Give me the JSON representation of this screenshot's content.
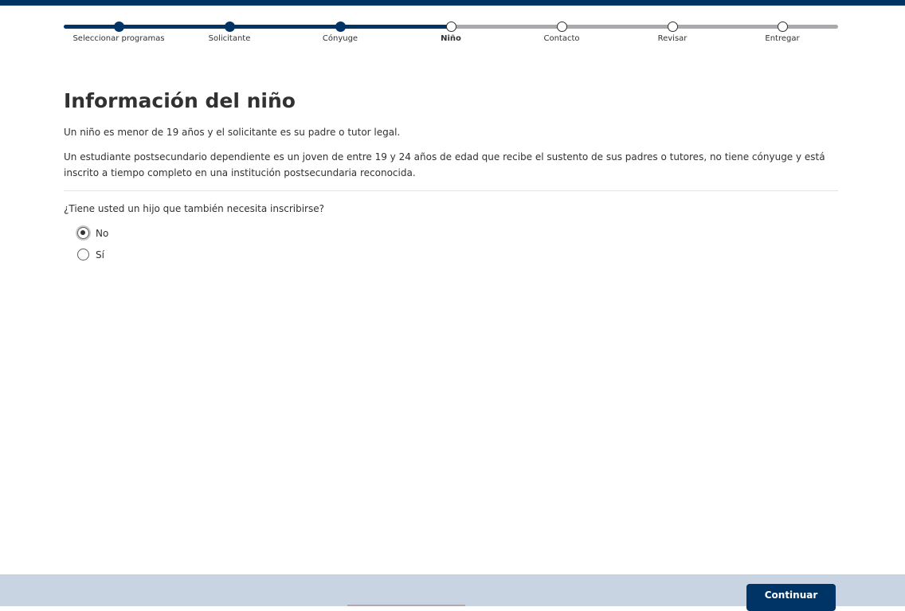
{
  "stepper": {
    "steps": [
      {
        "label": "Seleccionar programas",
        "state": "done"
      },
      {
        "label": "Solicitante",
        "state": "done"
      },
      {
        "label": "Cónyuge",
        "state": "done"
      },
      {
        "label": "Niño",
        "state": "current"
      },
      {
        "label": "Contacto",
        "state": "todo"
      },
      {
        "label": "Revisar",
        "state": "todo"
      },
      {
        "label": "Entregar",
        "state": "todo"
      }
    ],
    "progress_fraction": 0.5
  },
  "page": {
    "title": "Información del niño",
    "paragraph1": "Un niño es menor de 19 años y el solicitante es su padre o tutor legal.",
    "paragraph2": "Un estudiante postsecundario dependiente es un joven de entre 19 y 24 años de edad que recibe el sustento de sus padres o tutores, no tiene cónyuge y está inscrito a tiempo completo en una institución postsecundaria reconocida."
  },
  "question": {
    "text": "¿Tiene usted un hijo que también necesita inscribirse?",
    "options": [
      {
        "label": "No",
        "checked": true
      },
      {
        "label": "Sí",
        "checked": false
      }
    ]
  },
  "footer": {
    "continue_label": "Continuar"
  },
  "colors": {
    "brand": "#003366",
    "track_inactive": "#a7a9ac",
    "footer_bg": "#c8d4e1"
  }
}
